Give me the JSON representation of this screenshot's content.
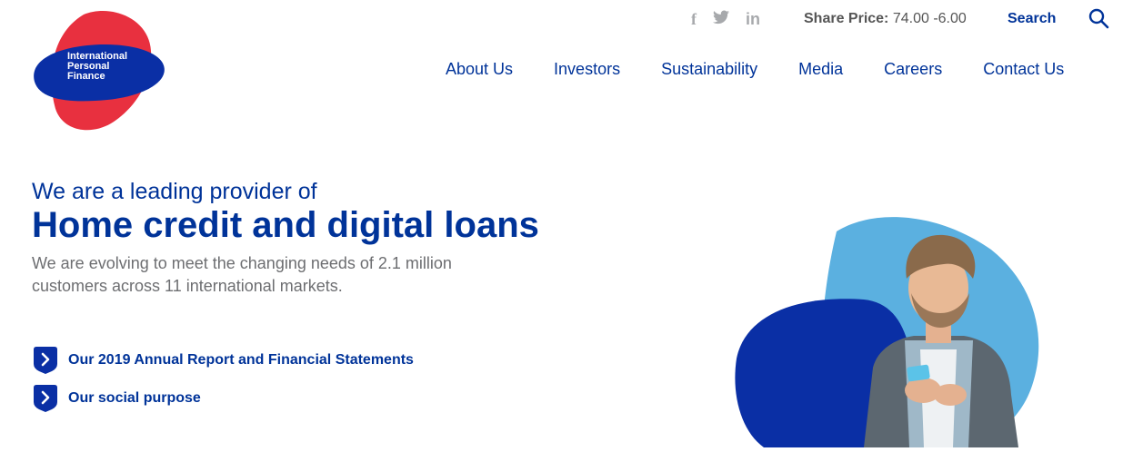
{
  "brand": {
    "logo_lines": [
      "International",
      "Personal",
      "Finance"
    ],
    "colors": {
      "red": "#e8303f",
      "blue": "#0a2fa5",
      "light_blue": "#5bb0e0"
    }
  },
  "topbar": {
    "social": [
      {
        "name": "facebook-icon",
        "glyph": "f"
      },
      {
        "name": "twitter-icon",
        "glyph": "🐦"
      },
      {
        "name": "linkedin-icon",
        "glyph": "in"
      }
    ],
    "share_label": "Share Price:",
    "share_value": "74.00 -6.00",
    "search_label": "Search"
  },
  "nav": {
    "items": [
      "About Us",
      "Investors",
      "Sustainability",
      "Media",
      "Careers",
      "Contact Us"
    ]
  },
  "hero": {
    "lead": "We are a leading provider of",
    "title": "Home credit and digital loans",
    "description": "We are evolving to meet the changing needs of 2.1 million customers across 11 international markets."
  },
  "links": [
    {
      "label": "Our 2019 Annual Report and Financial Statements"
    },
    {
      "label": "Our social purpose"
    }
  ]
}
